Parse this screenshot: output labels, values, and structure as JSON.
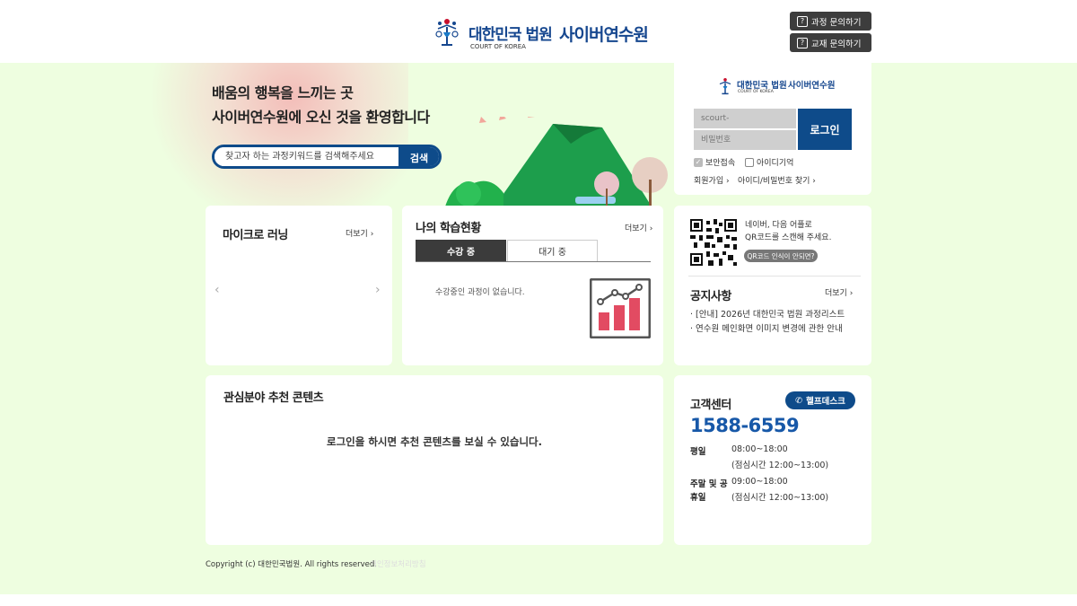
{
  "header": {
    "logo_court_ko": "대한민국 법원",
    "logo_court_en": "COURT OF KOREA",
    "logo_cyber": "사이버연수원",
    "course_inquiry": "과정 문의하기",
    "material_inquiry": "교재 문의하기"
  },
  "hero": {
    "title_line1": "배움의 행복을 느끼는 곳",
    "title_line2": "사이버연수원에 오신 것을 환영합니다",
    "search_placeholder": "찾고자 하는 과정키워드를 검색해주세요",
    "search_button": "검색"
  },
  "login": {
    "logo_court_ko": "대한민국 법원",
    "logo_court_en": "COURT OF KOREA",
    "logo_cyber": "사이버연수원",
    "id_placeholder": "scourt-",
    "password_placeholder": "비밀번호",
    "login_button": "로그인",
    "secure_login": "보안접속",
    "remember_id": "아이디기억",
    "signup": "회원가입",
    "find_id_pw": "아이디/비밀번호 찾기"
  },
  "micro": {
    "title": "마이크로 러닝",
    "more": "더보기"
  },
  "status": {
    "title": "나의 학습현황",
    "more": "더보기",
    "tab_studying": "수강 중",
    "tab_waiting": "대기 중",
    "empty": "수강중인 과정이 없습니다."
  },
  "qr": {
    "line1": "네이버, 다음 어플로",
    "line2": "QR코드를 스캔해 주세요.",
    "help": "QR코드 인식이 안되면?"
  },
  "notice": {
    "title": "공지사항",
    "more": "더보기",
    "items": [
      "[안내] 2026년 대한민국 법원 과정리스트",
      "연수원 메인화면 이미지 변경에 관한 안내"
    ]
  },
  "recommend": {
    "title": "관심분야 추천 콘텐츠",
    "message": "로그인을 하시면 추천 콘텐츠를 보실 수 있습니다."
  },
  "customer": {
    "title": "고객센터",
    "helpdesk": "헬프데스크",
    "phone": "1588-6559",
    "weekday_label": "평일",
    "weekday_hours": "08:00~18:00",
    "weekday_lunch": "(점심시간 12:00~13:00)",
    "weekend_label_1": "주말 및 공",
    "weekend_label_2": "휴일",
    "weekend_hours": "09:00~18:00",
    "weekend_lunch": "(점심시간 12:00~13:00)"
  },
  "footer": {
    "copyright": "Copyright (c) 대한민국법원. All rights reserved.",
    "link": "개인정보처리방침"
  },
  "colors": {
    "brand_blue": "#0e4b8a",
    "background_green": "#eefee0",
    "phone_blue": "#1758a8"
  }
}
